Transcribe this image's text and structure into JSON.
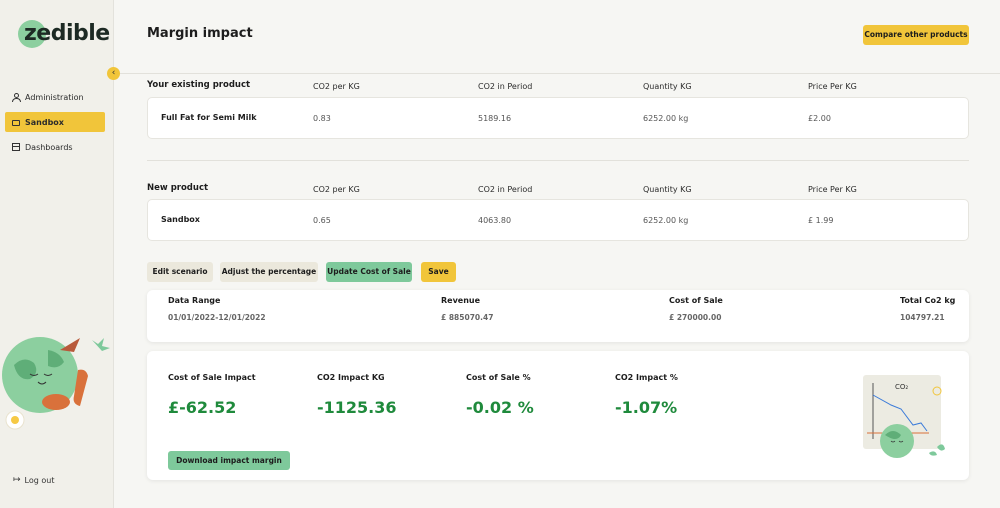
{
  "app": {
    "logo_text": "zedible"
  },
  "sidebar": {
    "items": [
      {
        "label": "Administration",
        "icon": "user-icon"
      },
      {
        "label": "Sandbox",
        "icon": "folder-icon",
        "active": true
      },
      {
        "label": "Dashboards",
        "icon": "dashboard-icon"
      }
    ],
    "logout_label": "Log out"
  },
  "header": {
    "title": "Margin impact",
    "compare_button": "Compare other products"
  },
  "existing_product": {
    "section_title": "Your existing product",
    "columns": [
      "CO2 per KG",
      "CO2 in Period",
      "Quantity KG",
      "Price Per KG"
    ],
    "name": "Full Fat for Semi Milk",
    "values": [
      "0.83",
      "5189.16",
      "6252.00 kg",
      "£2.00"
    ]
  },
  "new_product": {
    "section_title": "New product",
    "columns": [
      "CO2 per KG",
      "CO2 in Period",
      "Quantity KG",
      "Price Per KG"
    ],
    "name": "Sandbox",
    "values": [
      "0.65",
      "4063.80",
      "6252.00 kg",
      "£ 1.99"
    ]
  },
  "actions": {
    "edit_scenario": "Edit scenario",
    "adjust_percentage": "Adjust the percentage",
    "update_cost": "Update Cost of Sale",
    "save": "Save"
  },
  "summary": {
    "labels": [
      "Data Range",
      "Revenue",
      "Cost of Sale",
      "Total Co2 kg"
    ],
    "values": [
      "01/01/2022-12/01/2022",
      "£ 885070.47",
      "£ 270000.00",
      "104797.21"
    ]
  },
  "impact": {
    "labels": [
      "Cost of Sale Impact",
      "CO2 Impact KG",
      "Cost of Sale %",
      "CO2 Impact %"
    ],
    "values": [
      "£-62.52",
      "-1125.36",
      "-0.02 %",
      "-1.07%"
    ],
    "download_button": "Download impact margin",
    "illustration_label": "CO₂"
  },
  "colors": {
    "accent_yellow": "#f1c53a",
    "accent_green": "#7ec99b",
    "impact_green": "#1f8a3c"
  }
}
